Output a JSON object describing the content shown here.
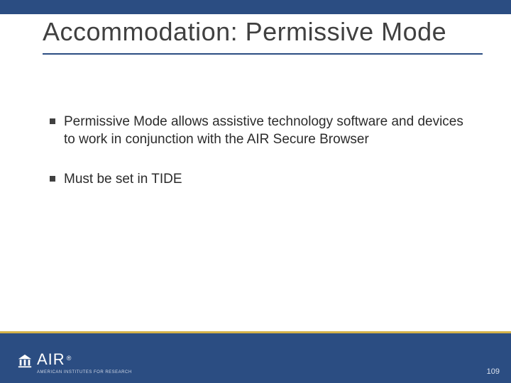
{
  "colors": {
    "brand_blue": "#2b4d82",
    "accent_gold": "#d4b24a",
    "text_dark": "#404040"
  },
  "title": "Accommodation: Permissive Mode",
  "bullets": [
    "Permissive Mode allows assistive technology software and devices to work in conjunction with the AIR Secure Browser",
    "Must be set in TIDE"
  ],
  "footer": {
    "logo_text": "AIR",
    "logo_registered": "®",
    "logo_subtext": "AMERICAN INSTITUTES FOR RESEARCH",
    "page_number": "109"
  }
}
